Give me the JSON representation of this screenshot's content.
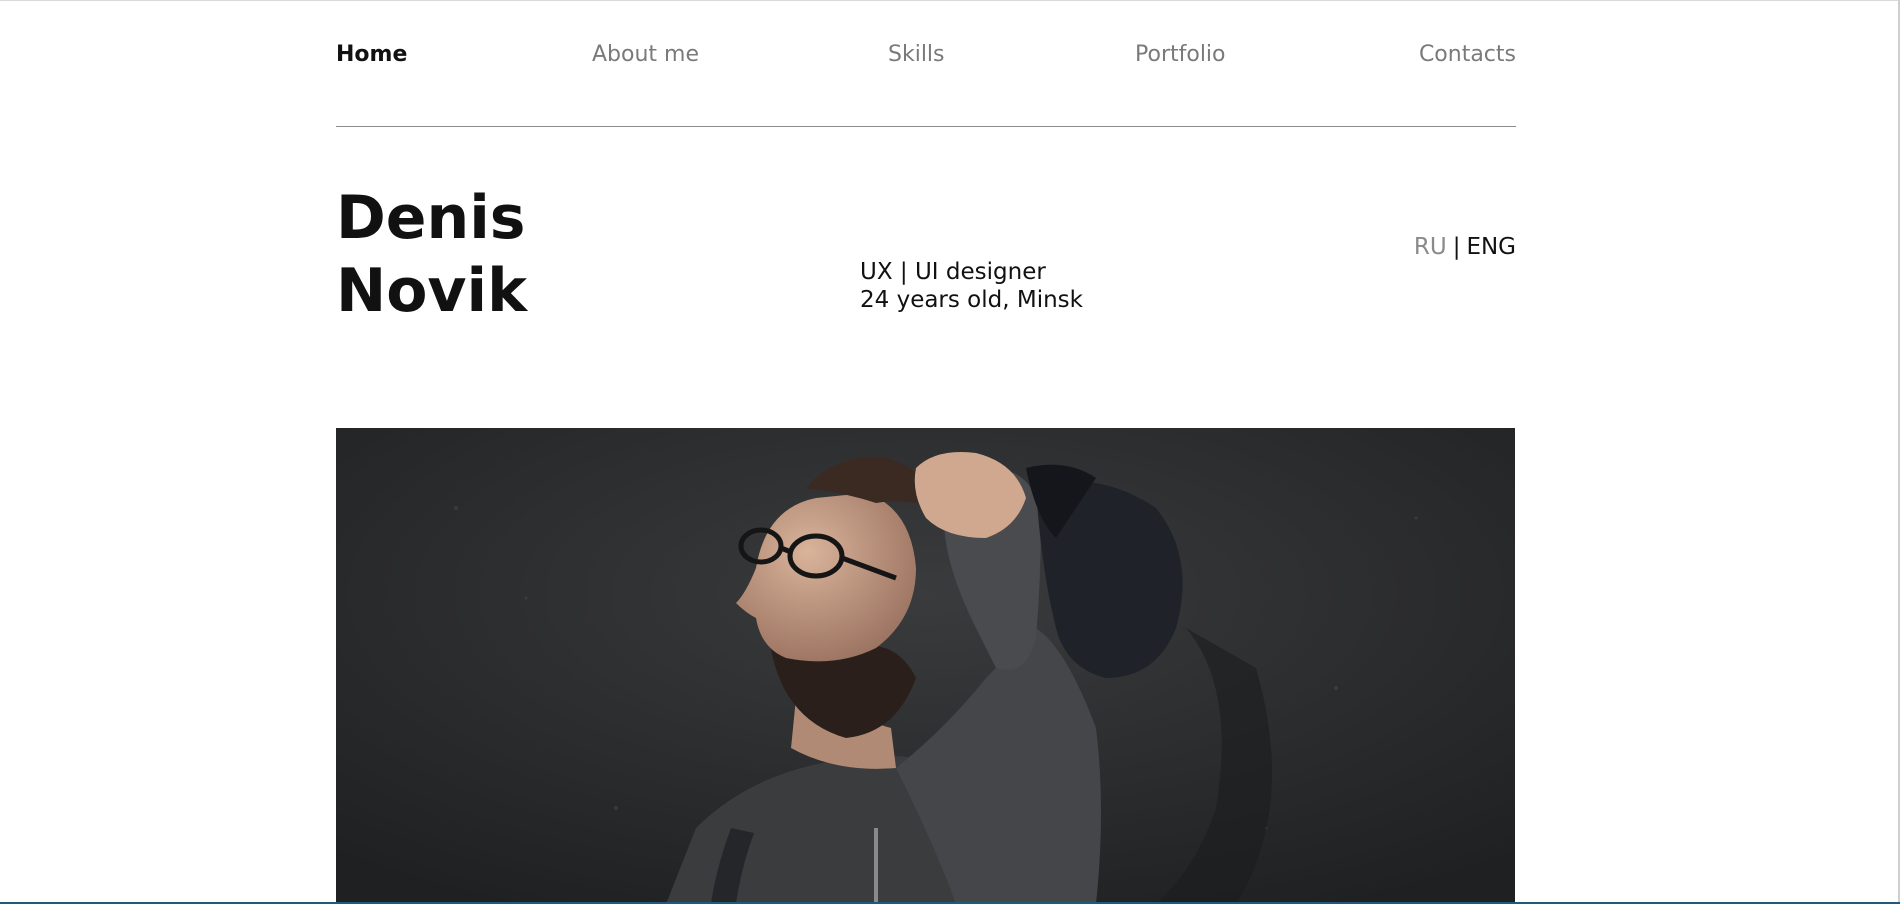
{
  "nav": {
    "items": [
      {
        "label": "Home",
        "active": true
      },
      {
        "label": "About me",
        "active": false
      },
      {
        "label": "Skills",
        "active": false
      },
      {
        "label": "Portfolio",
        "active": false
      },
      {
        "label": "Contacts",
        "active": false
      }
    ]
  },
  "hero": {
    "first_name": "Denis",
    "last_name": "Novik",
    "role": "UX | UI designer",
    "details": "24 years old, Minsk"
  },
  "language": {
    "ru": "RU",
    "separator": "|",
    "en": "ENG",
    "active": "ENG"
  },
  "photo": {
    "icon": "portrait-photo"
  },
  "colors": {
    "text": "#111111",
    "muted": "#7a7a7a",
    "divider": "#8c8c8c",
    "photo_background": "#2a2b2d",
    "bottom_accent": "#1f5a7a"
  }
}
